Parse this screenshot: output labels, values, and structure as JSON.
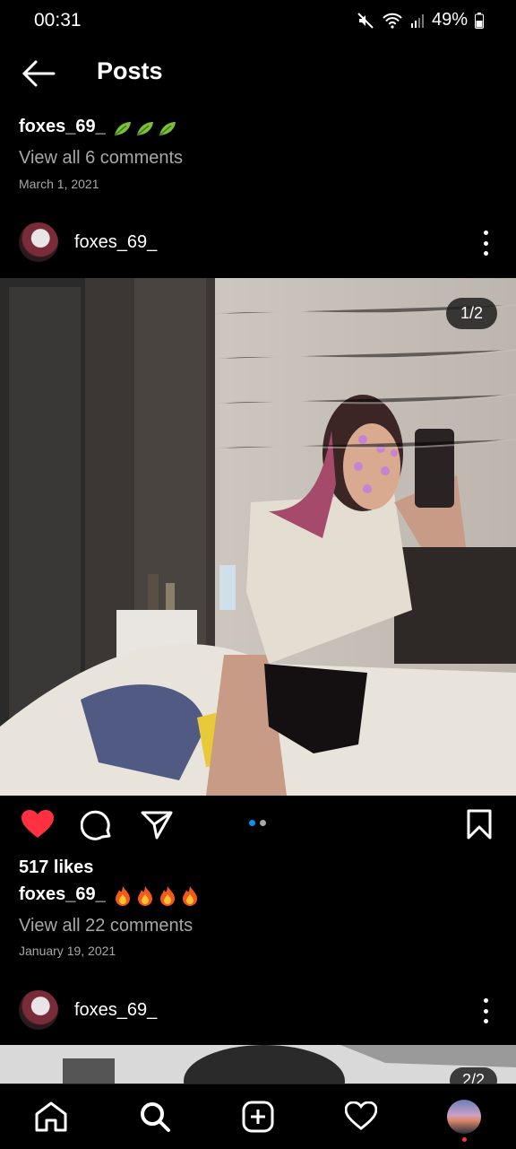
{
  "status_bar": {
    "time": "00:31",
    "battery": "49%"
  },
  "header": {
    "title": "Posts"
  },
  "prev_post": {
    "username": "foxes_69_",
    "comments_link": "View all 6 comments",
    "date": "March 1, 2021"
  },
  "post": {
    "username": "foxes_69_",
    "image_counter": "1/2",
    "likes": "517 likes",
    "caption_user": "foxes_69_",
    "comments_link": "View all 22 comments",
    "date": "January 19, 2021",
    "carousel_active_index": 0,
    "carousel_count": 2,
    "liked": true
  },
  "next_post": {
    "username": "foxes_69_",
    "image_counter": "2/2"
  },
  "colors": {
    "like_red": "#ff3040",
    "carousel_active": "#0095f6",
    "muted_text": "#a8a8a8"
  },
  "bottom_nav": [
    "home-icon",
    "search-icon",
    "create-icon",
    "activity-icon",
    "profile-avatar"
  ]
}
